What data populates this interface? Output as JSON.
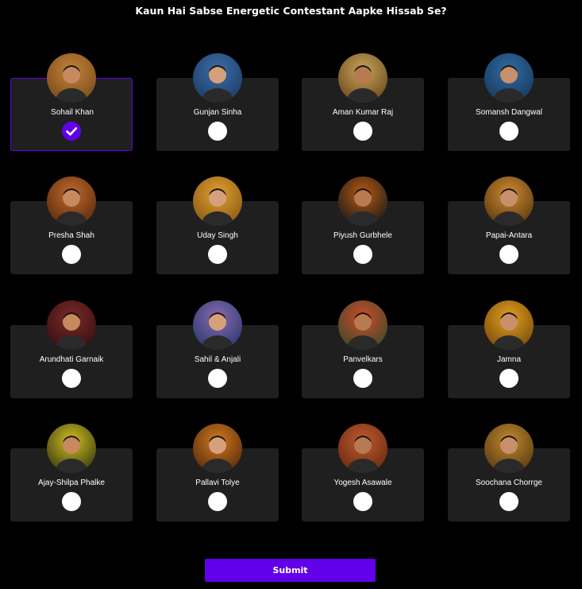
{
  "poll": {
    "question": "Kaun Hai Sabse Energetic Contestant Aapke Hissab Se?",
    "submit_label": "Submit",
    "accent_color": "#6200ea",
    "contestants": [
      {
        "name": "Sohail Khan",
        "selected": true,
        "icon": "contestant-photo"
      },
      {
        "name": "Gunjan Sinha",
        "selected": false,
        "icon": "contestant-photo"
      },
      {
        "name": "Aman Kumar Raj",
        "selected": false,
        "icon": "contestant-photo"
      },
      {
        "name": "Somansh Dangwal",
        "selected": false,
        "icon": "contestant-photo"
      },
      {
        "name": "Presha Shah",
        "selected": false,
        "icon": "contestant-photo"
      },
      {
        "name": "Uday Singh",
        "selected": false,
        "icon": "contestant-photo"
      },
      {
        "name": "Piyush Gurbhele",
        "selected": false,
        "icon": "contestant-photo"
      },
      {
        "name": "Papai-Antara",
        "selected": false,
        "icon": "contestant-photo"
      },
      {
        "name": "Arundhati Garnaik",
        "selected": false,
        "icon": "contestant-photo"
      },
      {
        "name": "Sahil & Anjali",
        "selected": false,
        "icon": "contestant-photo"
      },
      {
        "name": "Panvelkars",
        "selected": false,
        "icon": "contestant-photo"
      },
      {
        "name": "Jamna",
        "selected": false,
        "icon": "contestant-photo"
      },
      {
        "name": "Ajay-Shilpa Phalke",
        "selected": false,
        "icon": "contestant-photo"
      },
      {
        "name": "Pallavi Tolye",
        "selected": false,
        "icon": "contestant-photo"
      },
      {
        "name": "Yogesh Asawale",
        "selected": false,
        "icon": "contestant-photo"
      },
      {
        "name": "Soochana Chorrge",
        "selected": false,
        "icon": "contestant-photo"
      }
    ]
  }
}
